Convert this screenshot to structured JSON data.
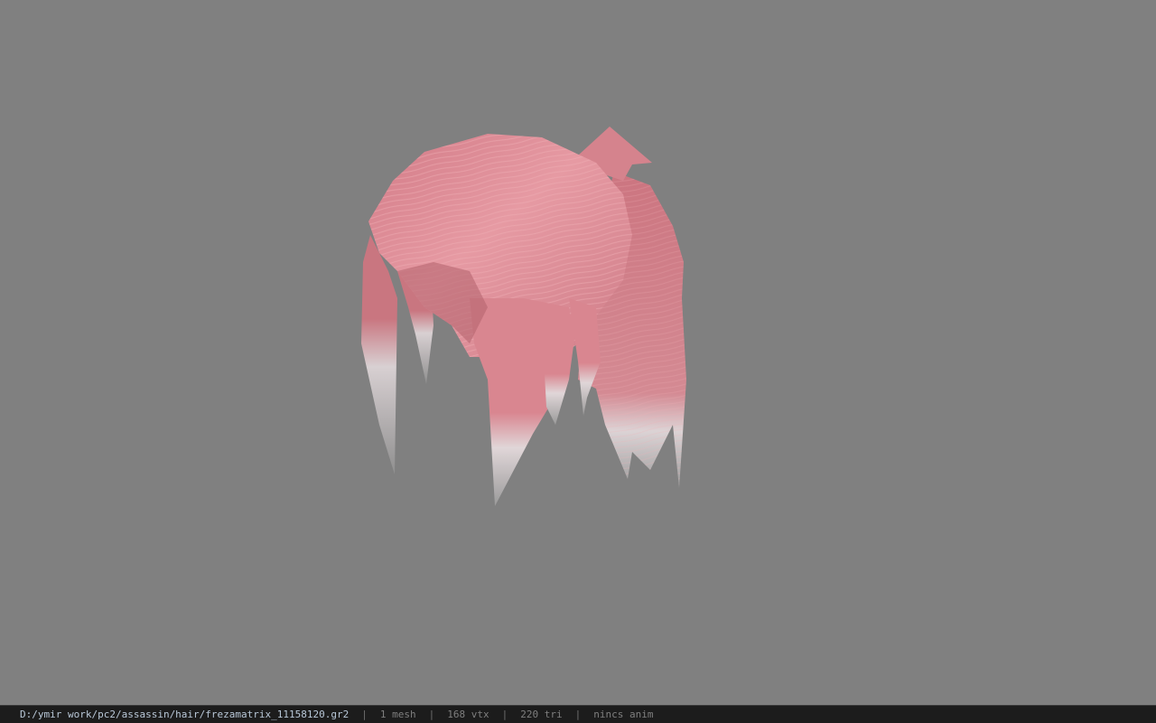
{
  "viewer": {
    "background_color": "#808080",
    "model": {
      "name": "hair-mesh",
      "primary_color": "#d9878f",
      "tip_color": "#d8d8d8"
    }
  },
  "status_bar": {
    "file_path": "D:/ymir work/pc2/assassin/hair/frezamatrix_11158120.gr2",
    "separator": "|",
    "mesh_count": "1 mesh",
    "vertex_count": "168 vtx",
    "triangle_count": "220 tri",
    "anim_status": "nincs anim"
  }
}
